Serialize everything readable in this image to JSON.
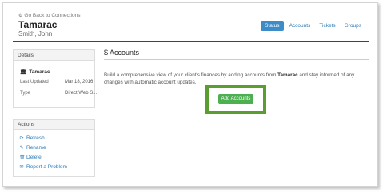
{
  "header": {
    "back_link": "Go Back to Connections",
    "title": "Tamarac",
    "subtitle": "Smith, John"
  },
  "tabs": [
    {
      "label": "Status",
      "active": true
    },
    {
      "label": "Accounts",
      "active": false
    },
    {
      "label": "Tickets",
      "active": false
    },
    {
      "label": "Groups",
      "active": false
    }
  ],
  "details": {
    "heading": "Details",
    "name": "Tamarac",
    "last_updated_label": "Last Updated",
    "last_updated_value": "Mar 18, 2016",
    "type_label": "Type",
    "type_value": "Direct Web S..."
  },
  "actions": {
    "heading": "Actions",
    "items": [
      "Refresh",
      "Rename",
      "Delete",
      "Report a Problem"
    ]
  },
  "main": {
    "title_symbol": "$",
    "title": "Accounts",
    "desc_before": "Build a comprehensive view of your client's finances by adding accounts from ",
    "desc_bold": "Tamarac",
    "desc_after": " and stay informed of any changes with automatic account updates.",
    "button": "Add Accounts"
  },
  "colors": {
    "accent": "#3d8bc7",
    "link": "#2a7ab8",
    "button": "#4caf50",
    "highlight": "#5a9e2f"
  }
}
